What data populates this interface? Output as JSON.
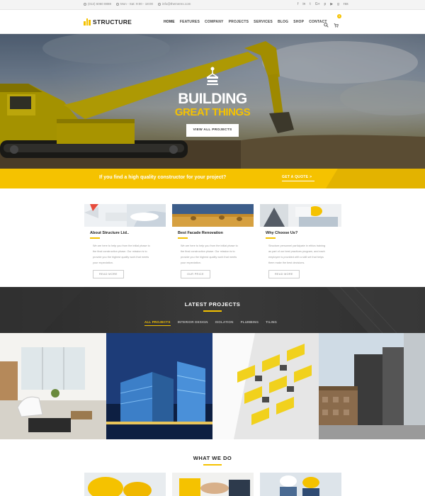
{
  "topbar": {
    "phone": "(012) 6060 8888",
    "hours": "Mon - Sat: 9:00 - 18:00",
    "email": "info@themerex.com",
    "social": [
      "f",
      "in",
      "t",
      "G+",
      "p",
      "▶",
      "g",
      "rss"
    ]
  },
  "header": {
    "logo": "STRUCTURE",
    "nav": [
      "HOME",
      "FEATURES",
      "COMPANY",
      "PROJECTS",
      "SERVICES",
      "BLOG",
      "SHOP",
      "CONTACT"
    ],
    "cart_count": "0"
  },
  "hero": {
    "title": "BUILDING",
    "subtitle": "GREAT THINGS",
    "button": "VIEW ALL PROJECTS"
  },
  "cta": {
    "text": "If you find a high quality constructor for your project?",
    "button": "GET A QUOTE  >"
  },
  "features": [
    {
      "title": "About Structure Ltd..",
      "text": [
        "We are here to help you from the initial phase to",
        "the final construction phase. Our mission is to",
        "provide you the highest quality work that meets",
        "your expectation."
      ],
      "button": "READ MORE"
    },
    {
      "title": "Best Facade Renovation",
      "text": [
        "We are here to help you from the initial phase to",
        "the final construction phase. Our mission is to",
        "provide you the highest quality work that meets",
        "your expectation."
      ],
      "button": "OUR PRICE"
    },
    {
      "title": "Why Choose Us?",
      "text": [
        "Structure personnel participate in ethics training",
        "as part of our best practices program, and each",
        "employee is provided with a skill set that helps",
        "them make the best decisions."
      ],
      "button": "READ MORE"
    }
  ],
  "projects": {
    "heading": "LATEST PROJECTS",
    "filters": [
      "ALL PROJECTS",
      "INTERIOR DESIGN",
      "ISOLATION",
      "PLUMBING",
      "TILING"
    ]
  },
  "what_we_do": {
    "heading": "WHAT WE DO"
  },
  "colors": {
    "accent": "#f5c200",
    "dark": "#2b2b2b"
  }
}
